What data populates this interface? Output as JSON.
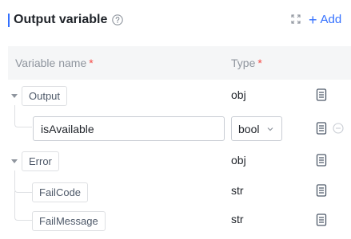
{
  "header": {
    "title": "Output variable",
    "add_label": "Add",
    "add_plus": "+"
  },
  "table": {
    "col_name": "Variable name",
    "col_type": "Type",
    "required_mark": "*"
  },
  "rows": [
    {
      "name": "Output",
      "type": "obj",
      "expandable": true
    },
    {
      "name": "isAvailable",
      "type": "bool",
      "editing": true
    },
    {
      "name": "Error",
      "type": "obj",
      "expandable": true
    },
    {
      "name": "FailCode",
      "type": "str"
    },
    {
      "name": "FailMessage",
      "type": "str"
    }
  ],
  "colors": {
    "accent": "#3370ff",
    "required": "#f54a45",
    "header_bg": "#f5f6f7"
  }
}
